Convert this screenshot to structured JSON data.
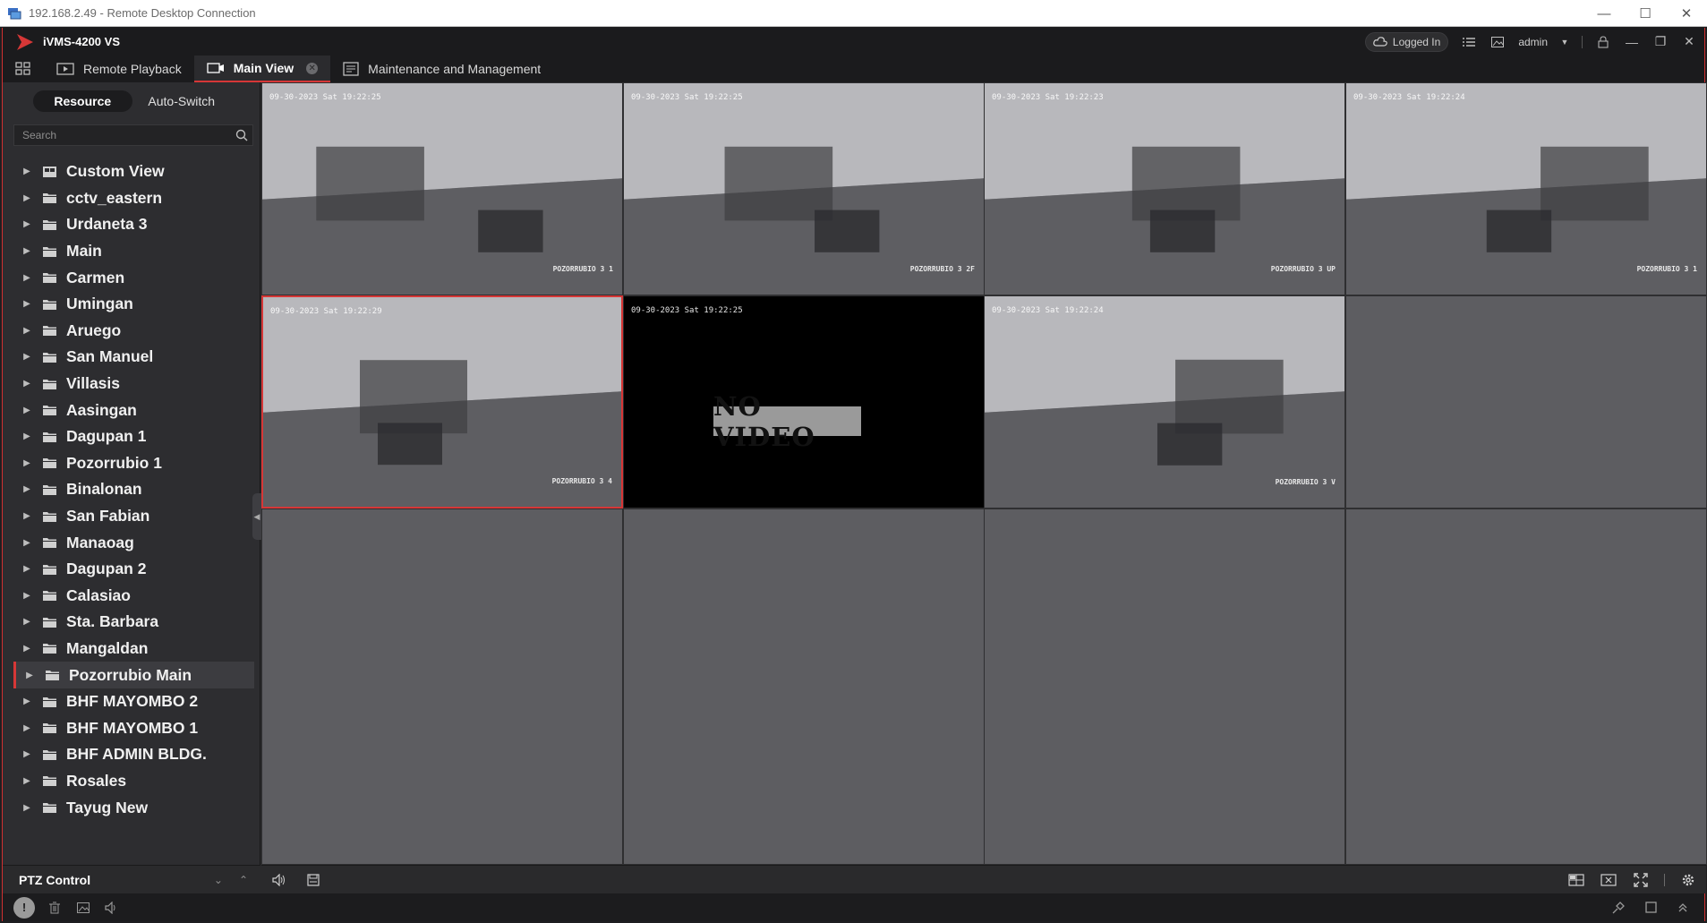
{
  "window": {
    "title": "192.168.2.49 - Remote Desktop Connection",
    "controls": [
      "minimize",
      "maximize",
      "close"
    ]
  },
  "app": {
    "name": "iVMS-4200 VS",
    "status": "Logged In",
    "user": "admin",
    "accent": "#d63737"
  },
  "tabs": [
    {
      "label": "Remote Playback",
      "icon": "playback-icon"
    },
    {
      "label": "Main View",
      "icon": "main-view-icon",
      "active": true
    },
    {
      "label": "Maintenance and Management",
      "icon": "maintenance-icon"
    }
  ],
  "sidebar": {
    "segments": [
      {
        "label": "Resource",
        "active": true
      },
      {
        "label": "Auto-Switch"
      }
    ],
    "search_placeholder": "Search",
    "items": [
      {
        "label": "Custom View",
        "icon": "custom-view-icon"
      },
      {
        "label": "cctv_eastern"
      },
      {
        "label": "Urdaneta 3"
      },
      {
        "label": "Main"
      },
      {
        "label": "Carmen"
      },
      {
        "label": "Umingan"
      },
      {
        "label": "Aruego"
      },
      {
        "label": "San Manuel"
      },
      {
        "label": "Villasis"
      },
      {
        "label": "Aasingan"
      },
      {
        "label": "Dagupan 1"
      },
      {
        "label": "Pozorrubio 1"
      },
      {
        "label": "Binalonan"
      },
      {
        "label": "San Fabian"
      },
      {
        "label": "Manaoag"
      },
      {
        "label": "Dagupan 2"
      },
      {
        "label": "Calasiao"
      },
      {
        "label": "Sta. Barbara"
      },
      {
        "label": "Mangaldan"
      },
      {
        "label": "Pozorrubio Main",
        "selected": true
      },
      {
        "label": "BHF MAYOMBO 2"
      },
      {
        "label": "BHF MAYOMBO 1"
      },
      {
        "label": "BHF ADMIN BLDG."
      },
      {
        "label": "Rosales"
      },
      {
        "label": "Tayug New"
      }
    ],
    "ptz_label": "PTZ Control"
  },
  "grid": {
    "rows": 3,
    "cols": 4,
    "cells": [
      {
        "state": "video",
        "timestamp": "09-30-2023 Sat 19:22:25",
        "camera": "POZORRUBIO 3 1"
      },
      {
        "state": "video",
        "timestamp": "09-30-2023 Sat 19:22:25",
        "camera": "POZORRUBIO 3 2F"
      },
      {
        "state": "video",
        "timestamp": "09-30-2023 Sat 19:22:23",
        "camera": "POZORRUBIO 3 UP"
      },
      {
        "state": "video",
        "timestamp": "09-30-2023 Sat 19:22:24",
        "camera": "POZORRUBIO 3 1"
      },
      {
        "state": "video",
        "timestamp": "09-30-2023 Sat 19:22:29",
        "camera": "POZORRUBIO 3 4",
        "selected": true
      },
      {
        "state": "novideo",
        "timestamp": "09-30-2023 Sat 19:22:25",
        "message": "NO VIDEO"
      },
      {
        "state": "video",
        "timestamp": "09-30-2023 Sat 19:22:24",
        "camera": "POZORRUBIO 3 V"
      },
      {
        "state": "empty"
      },
      {
        "state": "empty"
      },
      {
        "state": "empty"
      },
      {
        "state": "empty"
      },
      {
        "state": "empty"
      }
    ]
  }
}
